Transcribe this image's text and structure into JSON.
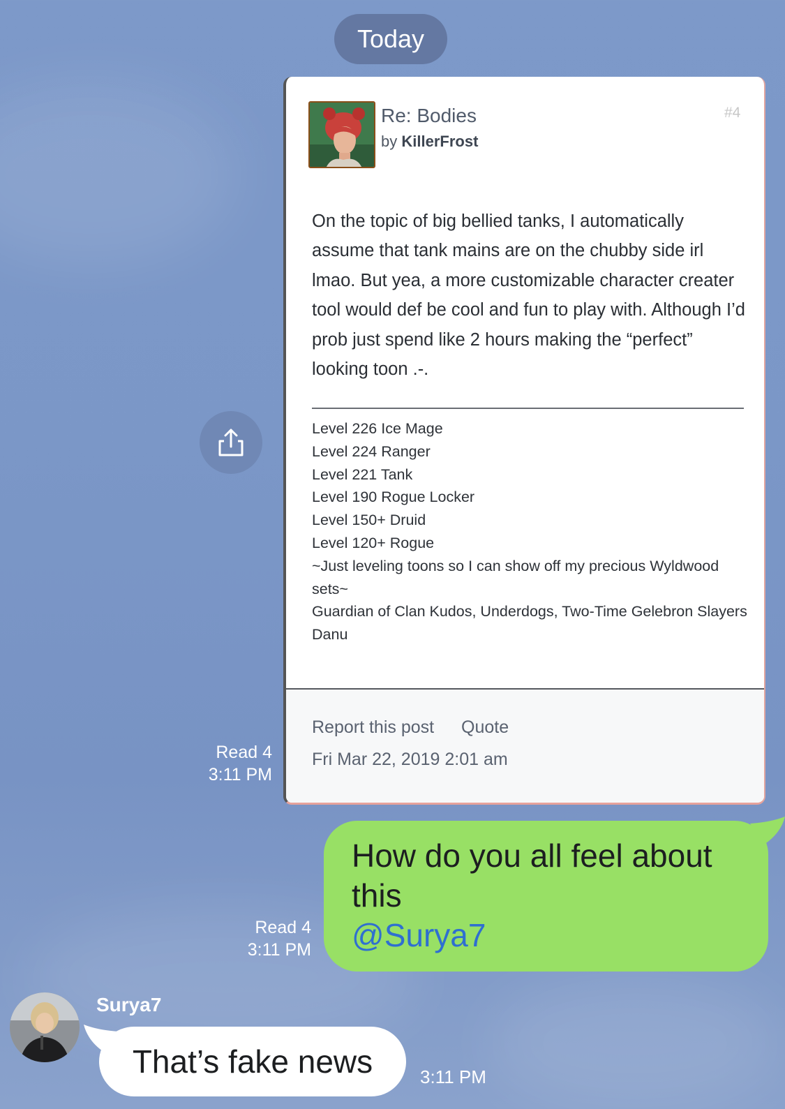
{
  "date_separator": "Today",
  "shared_post": {
    "title": "Re: Bodies",
    "by_prefix": "by",
    "author": "KillerFrost",
    "post_number": "#4",
    "body": "On the topic of big bellied tanks, I automatically assume that tank mains are on the chubby side irl lmao. But yea, a more customizable character creater tool would def be cool and fun to play with. Although I’d prob just spend like 2 hours making the “perfect” looking toon .-.",
    "signature_lines": [
      "Level 226 Ice Mage",
      "Level 224 Ranger",
      "Level 221 Tank",
      "Level 190 Rogue Locker",
      "Level 150+ Druid",
      "Level 120+ Rogue",
      "~Just leveling toons so I can show off my precious Wyldwood sets~",
      "Guardian of Clan Kudos, Underdogs, Two-Time Gelebron Slayers",
      "Danu"
    ],
    "report_label": "Report this post",
    "quote_label": "Quote",
    "post_date": "Fri Mar 22, 2019 2:01 am"
  },
  "card_meta": {
    "read": "Read 4",
    "time": "3:11 PM"
  },
  "outgoing_message": {
    "text": "How do you all feel about this",
    "mention": "@Surya7",
    "read": "Read 4",
    "time": "3:11 PM"
  },
  "incoming_message": {
    "sender": "Surya7",
    "text": "That’s fake news",
    "time": "3:11 PM"
  },
  "colors": {
    "background": "#7b97c7",
    "outgoing_bubble": "#98e065",
    "mention": "#2f6fd0",
    "date_pill": "#6478a2"
  },
  "icons": {
    "share": "share-icon",
    "post_avatar": "avatar",
    "user_avatar": "avatar"
  }
}
